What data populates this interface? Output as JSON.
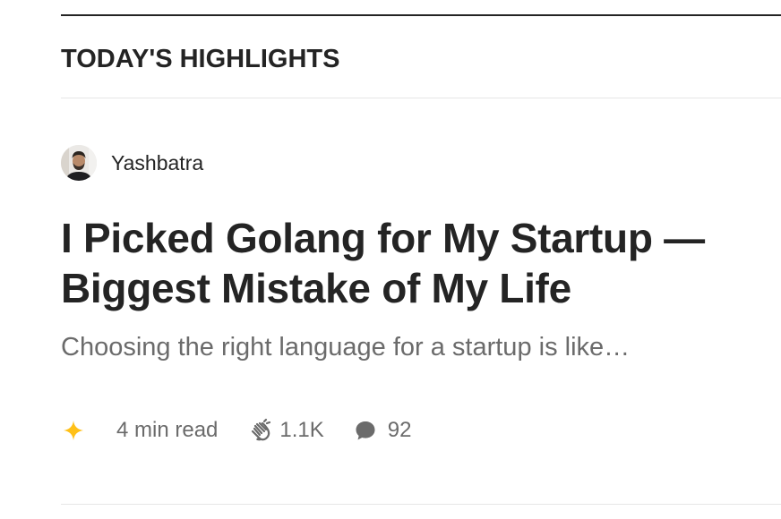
{
  "section": {
    "title": "TODAY'S HIGHLIGHTS"
  },
  "article": {
    "author": "Yashbatra",
    "headline": "I Picked Golang for My Startup — Biggest Mistake of My Life",
    "subtitle": "Choosing the right language for a startup is like…",
    "read_time": "4 min read",
    "claps": "1.1K",
    "responses": "92",
    "icons": {
      "member_badge": "sparkle-star-icon",
      "claps": "clap-hands-icon",
      "responses": "speech-bubble-icon"
    }
  },
  "colors": {
    "text_primary": "#242424",
    "text_secondary": "#6b6b6b",
    "divider": "#e6e6e6",
    "member_star": "#FFC017"
  }
}
